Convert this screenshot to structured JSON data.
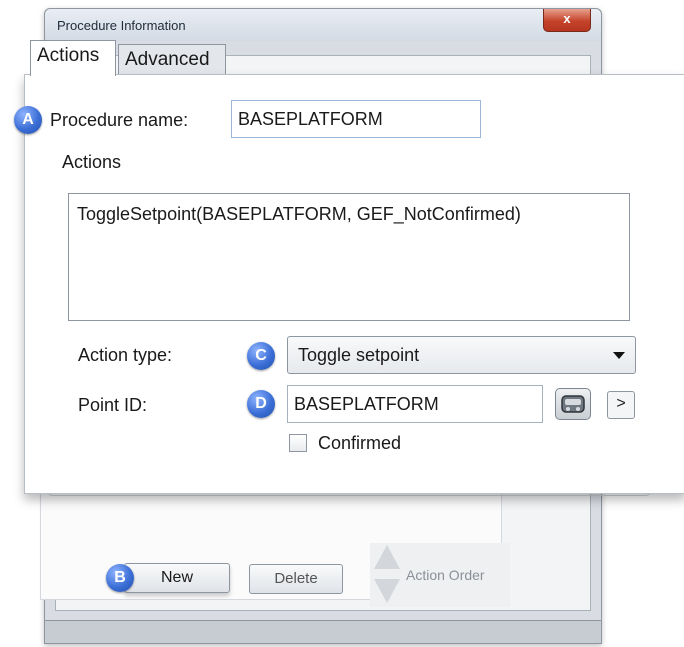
{
  "window": {
    "title": "Procedure Information",
    "close_label": "x"
  },
  "tabs": [
    {
      "label": "Actions",
      "selected": true
    },
    {
      "label": "Advanced",
      "selected": false
    }
  ],
  "form": {
    "procedure_name_label": "Procedure name:",
    "procedure_name_value": "BASEPLATFORM",
    "actions_group_label": "Actions",
    "actions_list": [
      "ToggleSetpoint(BASEPLATFORM, GEF_NotConfirmed)"
    ],
    "action_type_label": "Action type:",
    "action_type_value": "Toggle setpoint",
    "point_id_label": "Point ID:",
    "point_id_value": "BASEPLATFORM",
    "next_label": ">",
    "confirmed_label": "Confirmed",
    "confirmed_checked": false
  },
  "buttons": {
    "new_label": "New",
    "delete_label": "Delete",
    "action_order_label": "Action Order"
  },
  "callouts": {
    "a": "A",
    "b": "B",
    "c": "C",
    "d": "D"
  },
  "colors": {
    "callout_badge": "#3c6fd6",
    "close_button": "#c5432a",
    "input_border": "#9db7d8"
  },
  "icons": {
    "point_picker": "point-browser-icon",
    "next": "chevron-right-icon",
    "order_up": "arrow-up-icon",
    "order_down": "arrow-down-icon"
  }
}
